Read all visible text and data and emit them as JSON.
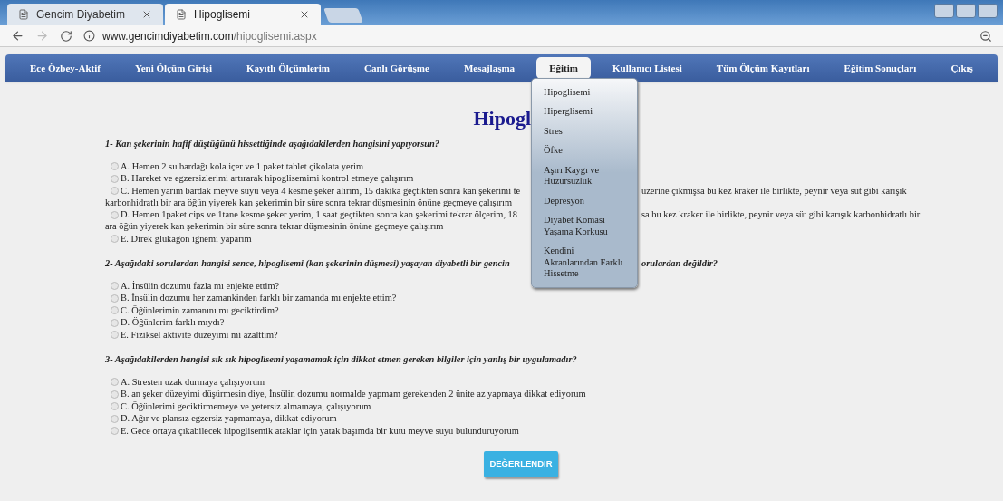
{
  "browser": {
    "tabs": [
      {
        "title": "Gencim Diyabetim",
        "selected": false
      },
      {
        "title": "Hipoglisemi",
        "selected": true
      }
    ],
    "url": {
      "host": "www.gencimdiyabetim.com",
      "path": "/hipoglisemi.aspx"
    }
  },
  "nav": [
    {
      "label": "Ece Özbey-Aktif",
      "selected": false
    },
    {
      "label": "Yeni Ölçüm Girişi",
      "selected": false
    },
    {
      "label": "Kayıtlı Ölçümlerim",
      "selected": false
    },
    {
      "label": "Canlı Görüşme",
      "selected": false
    },
    {
      "label": "Mesajlaşma",
      "selected": false
    },
    {
      "label": "Eğitim",
      "selected": true
    },
    {
      "label": "Kullanıcı Listesi",
      "selected": false
    },
    {
      "label": "Tüm Ölçüm Kayıtları",
      "selected": false
    },
    {
      "label": "Eğitim Sonuçları",
      "selected": false
    },
    {
      "label": "Çıkış",
      "selected": false
    }
  ],
  "dropdown": [
    "Hipoglisemi",
    "Hiperglisemi",
    "Stres",
    "Öfke",
    "Aşırı Kaygı ve Huzursuzluk",
    "Depresyon",
    "Diyabet Koması Yaşama Korkusu",
    "Kendini Akranlarından Farklı Hissetme"
  ],
  "heading": "Hipogl",
  "questions": [
    {
      "title": {
        "left": "1- Kan şekerinin hafif düştüğünü hissettiğinde aşağıdakilerden hangisini yapıyorsun?"
      },
      "options": [
        {
          "selected": false,
          "lines": [
            {
              "left": "A. Hemen 2 su bardağı kola içer ve 1 paket tablet çikolata yerim"
            }
          ]
        },
        {
          "selected": false,
          "lines": [
            {
              "left": "B. Hareket ve egzersizlerimi artırarak hipoglisemimi kontrol etmeye çalışırım"
            }
          ]
        },
        {
          "selected": false,
          "lines": [
            {
              "left": "C. Hemen yarım bardak meyve suyu veya 4 kesme şeker alırım, 15 dakika geçtikten sonra kan şekerimi te",
              "right": "üzerine çıkmışsa bu kez kraker ile birlikte, peynir veya süt gibi karışık"
            },
            {
              "left": "karbonhidratlı bir ara öğün yiyerek kan şekerimin bir süre sonra tekrar düşmesinin önüne geçmeye çalışırım"
            }
          ]
        },
        {
          "selected": false,
          "lines": [
            {
              "left": "D. Hemen 1paket cips ve 1tane kesme şeker yerim, 1 saat geçtikten sonra kan şekerimi tekrar ölçerim, 18",
              "right": "sa bu kez kraker ile birlikte, peynir veya süt gibi karışık karbonhidratlı bir"
            },
            {
              "left": "ara öğün yiyerek kan şekerimin bir süre sonra tekrar düşmesinin önüne geçmeye çalışırım"
            }
          ]
        },
        {
          "selected": false,
          "lines": [
            {
              "left": "E. Direk glukagon iğnemi yaparım"
            }
          ]
        }
      ]
    },
    {
      "title": {
        "left": "2- Aşağıdaki sorulardan hangisi sence, hipoglisemi (kan şekerinin düşmesi) yaşayan diyabetli bir gencin",
        "right": "orulardan değildir?"
      },
      "options": [
        {
          "selected": false,
          "lines": [
            {
              "left": "A. İnsülin dozumu fazla mı enjekte ettim?"
            }
          ]
        },
        {
          "selected": false,
          "lines": [
            {
              "left": "B. İnsülin dozumu her zamankinden farklı bir zamanda mı enjekte ettim?"
            }
          ]
        },
        {
          "selected": false,
          "lines": [
            {
              "left": "C. Öğünlerimin zamanını mı geciktirdim?"
            }
          ]
        },
        {
          "selected": false,
          "lines": [
            {
              "left": "D. Öğünlerim farklı mıydı?"
            }
          ]
        },
        {
          "selected": false,
          "lines": [
            {
              "left": "E. Fiziksel aktivite düzeyimi mi azalttım?"
            }
          ]
        }
      ]
    },
    {
      "title": {
        "left": "3- Aşağıdakilerden hangisi sık sık hipoglisemi yaşamamak için dikkat etmen gereken bilgiler için yanlış bir uygulamadır?"
      },
      "options": [
        {
          "selected": false,
          "lines": [
            {
              "left": "A. Stresten uzak durmaya çalışıyorum"
            }
          ]
        },
        {
          "selected": false,
          "lines": [
            {
              "left": "B. an şeker düzeyimi düşürmesin diye, İnsülin dozumu normalde yapmam gerekenden 2 ünite az yapmaya dikkat ediyorum"
            }
          ]
        },
        {
          "selected": false,
          "lines": [
            {
              "left": "C. Öğünlerimi geciktirmemeye ve yetersiz almamaya, çalışıyorum"
            }
          ]
        },
        {
          "selected": false,
          "lines": [
            {
              "left": "D. Ağır ve plansız egzersiz yapmamaya, dikkat ediyorum"
            }
          ]
        },
        {
          "selected": false,
          "lines": [
            {
              "left": "E. Gece ortaya çıkabilecek hipoglisemik ataklar için yatak başımda bir kutu meyve suyu bulunduruyorum"
            }
          ]
        }
      ]
    }
  ],
  "submit": "DEĞERLENDIR"
}
